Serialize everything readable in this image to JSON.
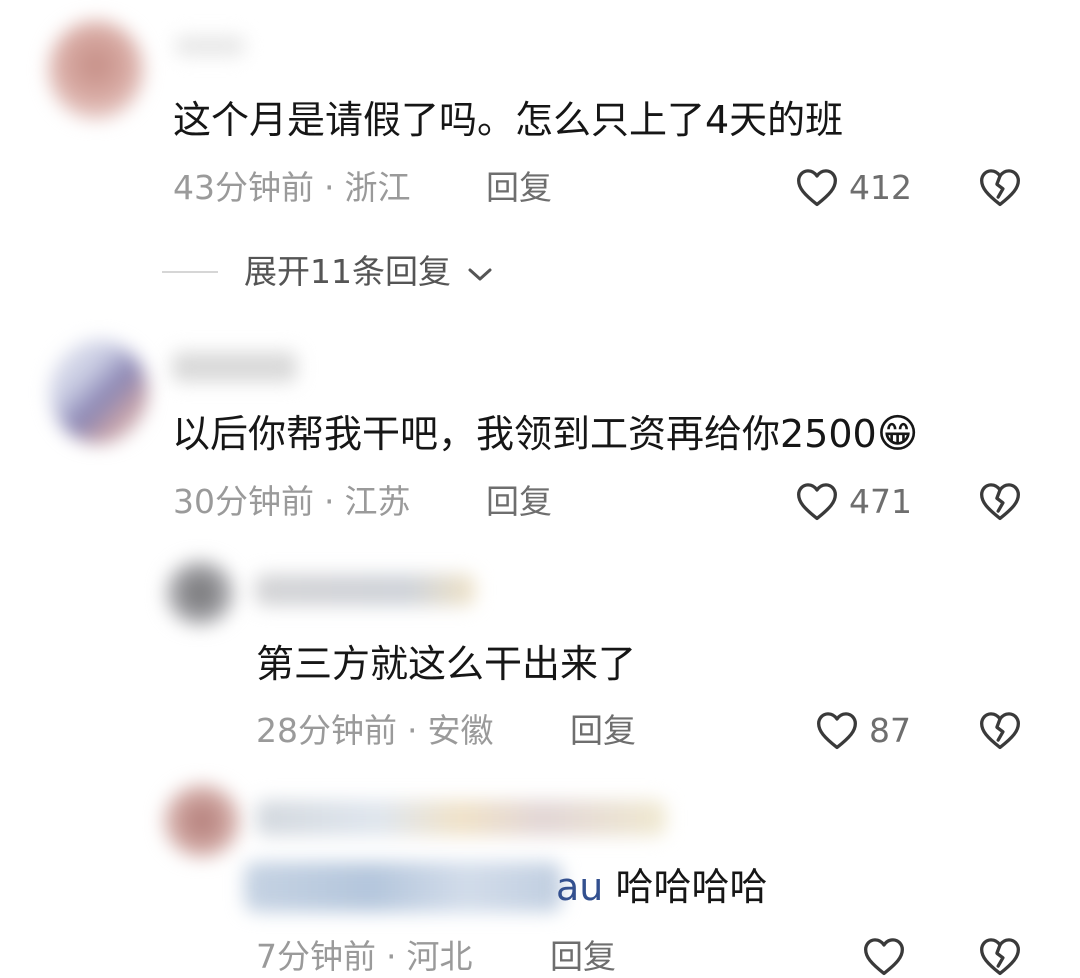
{
  "comments": [
    {
      "text": "这个月是请假了吗。怎么只上了4天的班",
      "time": "43分钟前",
      "location": "浙江",
      "reply_label": "回复",
      "likes": "412",
      "expand_label": "展开11条回复"
    },
    {
      "text": "以后你帮我干吧，我领到工资再给你2500",
      "emoji": "😁",
      "time": "30分钟前",
      "location": "江苏",
      "reply_label": "回复",
      "likes": "471"
    }
  ],
  "replies": [
    {
      "text": "第三方就这么干出来了",
      "time": "28分钟前",
      "location": "安徽",
      "reply_label": "回复",
      "likes": "87"
    },
    {
      "mention_visible": "au",
      "text": "哈哈哈哈",
      "time": "7分钟前",
      "location": "河北",
      "reply_label": "回复"
    }
  ],
  "separator": "·",
  "colors": {
    "text": "#161616",
    "meta": "#9a9a9a",
    "mention": "#33508f",
    "background": "#ffffff"
  },
  "icons": [
    "heart-outline-icon",
    "broken-heart-icon",
    "chevron-down-icon"
  ]
}
